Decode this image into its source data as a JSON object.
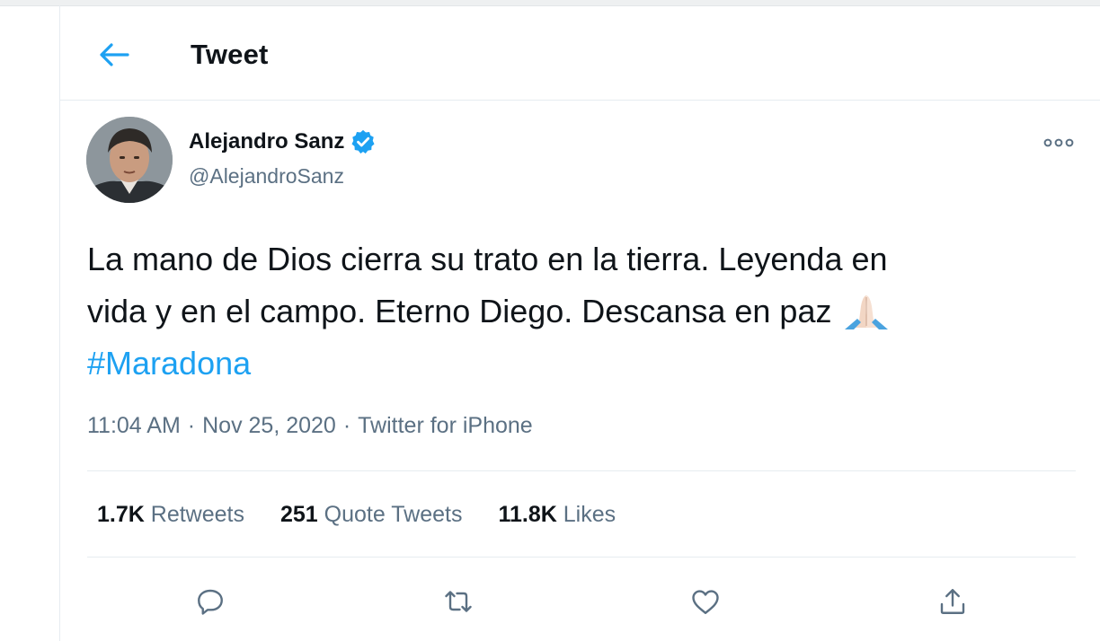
{
  "header": {
    "back_icon": "arrow-left-icon",
    "title": "Tweet"
  },
  "tweet": {
    "author": {
      "name": "Alejandro Sanz",
      "handle": "@AlejandroSanz",
      "verified_icon": "verified-badge-icon"
    },
    "text_line1": "La mano de Dios cierra su trato en la tierra. Leyenda en",
    "text_line2": "vida y en el campo. Eterno Diego. Descansa en paz",
    "emoji": "folded-hands-emoji",
    "hashtag": "#Maradona",
    "time": "11:04 AM",
    "date": "Nov 25, 2020",
    "source": "Twitter for iPhone"
  },
  "stats": {
    "retweets_count": "1.7K",
    "retweets_label": "Retweets",
    "quotes_count": "251",
    "quotes_label": "Quote Tweets",
    "likes_count": "11.8K",
    "likes_label": "Likes"
  },
  "actions": [
    "reply-icon",
    "retweet-icon",
    "like-icon",
    "share-icon"
  ],
  "colors": {
    "accent": "#1da1f2",
    "secondary_text": "#5b7083",
    "primary_text": "#0f1419",
    "divider": "#e6ecf0"
  }
}
